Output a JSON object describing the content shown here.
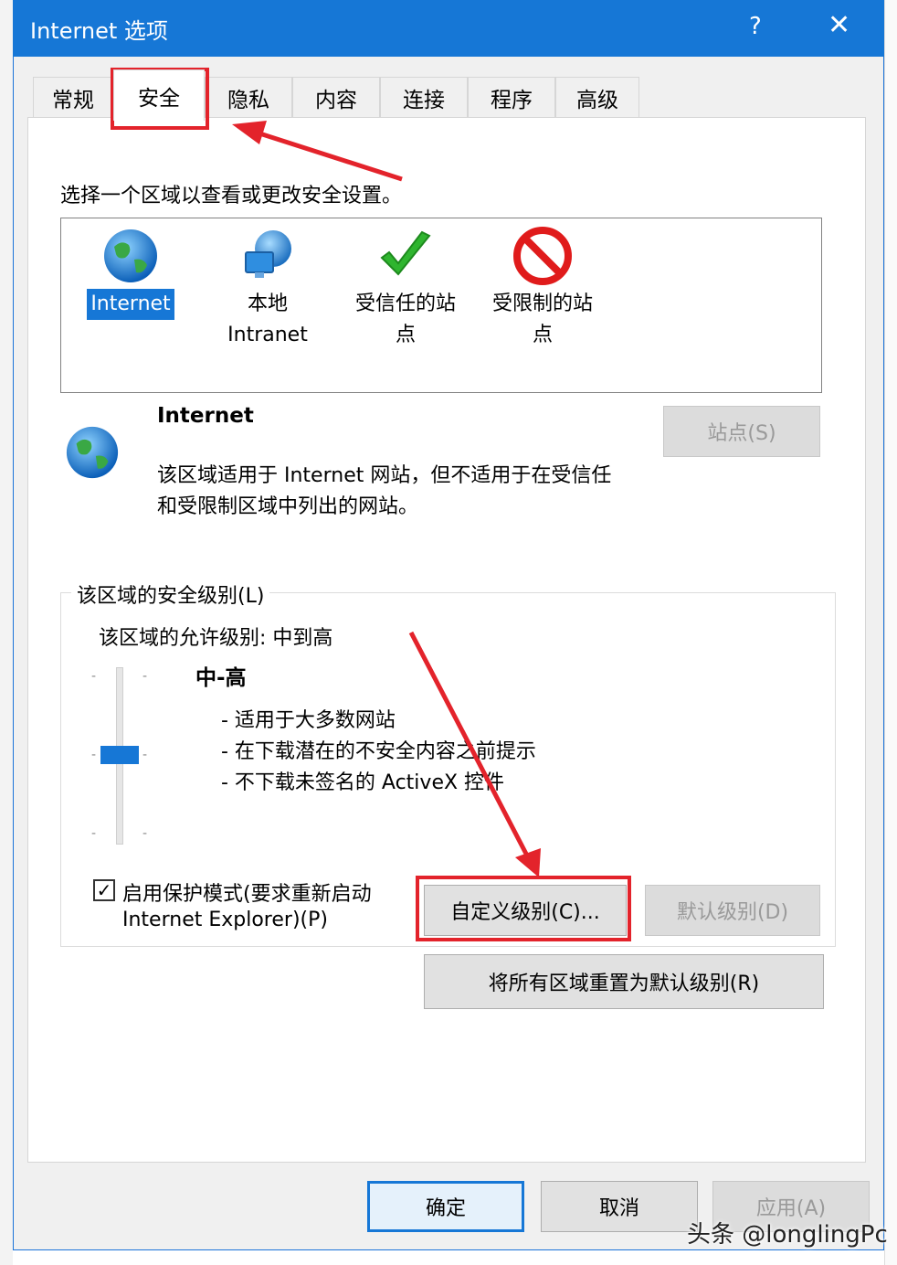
{
  "window": {
    "title": "Internet 选项",
    "help": "?",
    "close": "✕"
  },
  "tabs": [
    "常规",
    "安全",
    "隐私",
    "内容",
    "连接",
    "程序",
    "高级"
  ],
  "active_tab": "安全",
  "security": {
    "instruction": "选择一个区域以查看或更改安全设置。",
    "zones": [
      {
        "line1": "Internet",
        "line2": "",
        "icon": "globe-icon"
      },
      {
        "line1": "本地",
        "line2": "Intranet",
        "icon": "network-globe-icon"
      },
      {
        "line1": "受信任的站",
        "line2": "点",
        "icon": "checkmark-icon"
      },
      {
        "line1": "受限制的站",
        "line2": "点",
        "icon": "prohibited-icon"
      }
    ],
    "zone_title": "Internet",
    "zone_desc_line1": "该区域适用于 Internet 网站，但不适用于在受信任",
    "zone_desc_line2": "和受限制区域中列出的网站。",
    "sites_button": "站点(S)",
    "level_group": "该区域的安全级别(L)",
    "allowed_levels": "该区域的允许级别: 中到高",
    "level_name": "中-高",
    "level_bullets": [
      "- 适用于大多数网站",
      "- 在下载潜在的不安全内容之前提示",
      "- 不下载未签名的 ActiveX 控件"
    ],
    "slider_level": 0.5,
    "protected_mode_line1": "启用保护模式(要求重新启动",
    "protected_mode_line2": "Internet Explorer)(P)",
    "protected_mode_checked": true,
    "custom_level_button": "自定义级别(C)...",
    "default_level_button": "默认级别(D)",
    "reset_all_button": "将所有区域重置为默认级别(R)"
  },
  "footer": {
    "ok": "确定",
    "cancel": "取消",
    "apply": "应用(A)"
  },
  "watermark": "头条 @longlingPc",
  "colors": {
    "accent": "#1677d6",
    "highlight_red": "#e3232b"
  }
}
